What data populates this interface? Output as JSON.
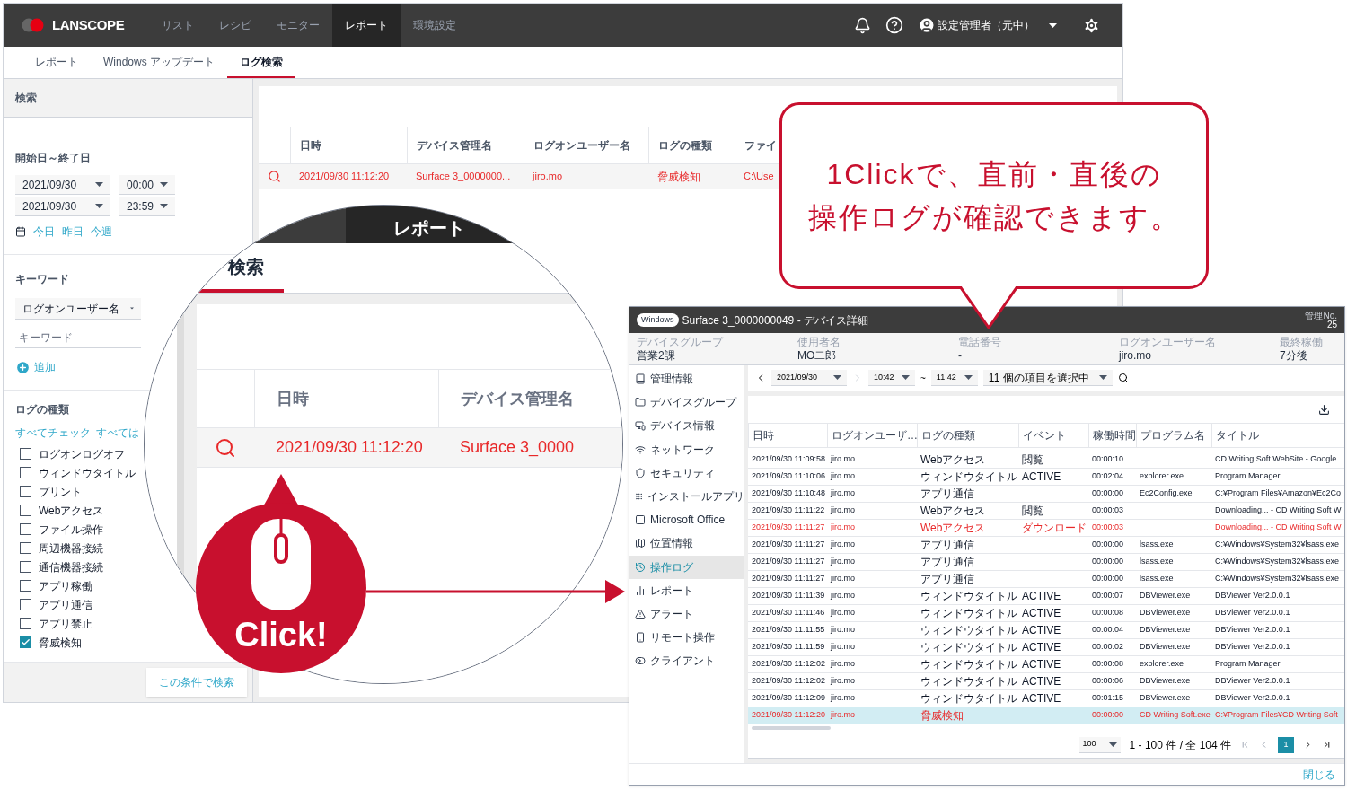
{
  "top_bar": {
    "logo": "LANSCOPE",
    "nav": [
      {
        "label": "リスト",
        "selected": false
      },
      {
        "label": "レシピ",
        "selected": false
      },
      {
        "label": "モニター",
        "selected": false
      },
      {
        "label": "レポート",
        "selected": true
      },
      {
        "label": "環境設定",
        "selected": false
      }
    ],
    "user": "設定管理者（元中）"
  },
  "sub_tabs": [
    {
      "label": "レポート",
      "selected": false
    },
    {
      "label": "Windows アップデート",
      "selected": false
    },
    {
      "label": "ログ検索",
      "selected": true
    }
  ],
  "search_panel": {
    "title": "検索",
    "period": {
      "label": "開始日～終了日",
      "start_date": "2021/09/30",
      "start_time": "00:00",
      "end_date": "2021/09/30",
      "end_time": "23:59",
      "quick_links": [
        "今日",
        "昨日",
        "今週"
      ]
    },
    "keyword": {
      "label": "キーワード",
      "field": "ログオンユーザー名",
      "placeholder": "キーワード",
      "add": "追加"
    },
    "log_types": {
      "label": "ログの種類",
      "check_all": "すべてチェック",
      "uncheck_all": "すべては",
      "items": [
        {
          "label": "ログオンログオフ",
          "checked": false
        },
        {
          "label": "ウィンドウタイトル",
          "checked": false
        },
        {
          "label": "プリント",
          "checked": false
        },
        {
          "label": "Webアクセス",
          "checked": false
        },
        {
          "label": "ファイル操作",
          "checked": false
        },
        {
          "label": "周辺機器接続",
          "checked": false
        },
        {
          "label": "通信機器接続",
          "checked": false
        },
        {
          "label": "アプリ稼働",
          "checked": false
        },
        {
          "label": "アプリ通信",
          "checked": false
        },
        {
          "label": "アプリ禁止",
          "checked": false
        },
        {
          "label": "脅威検知",
          "checked": true
        }
      ]
    },
    "search_button": "この条件で検索"
  },
  "results": {
    "columns": [
      "日時",
      "デバイス管理名",
      "ログオンユーザー名",
      "ログの種類",
      "ファイ"
    ],
    "rows": [
      {
        "cells": [
          "2021/09/30 11:12:20",
          "Surface 3_0000000...",
          "jiro.mo",
          "脅威検知",
          "C:\\Use"
        ],
        "alert": true
      }
    ]
  },
  "magnifier": {
    "tab": "レポート",
    "subtab": "検索",
    "columns": [
      "日時",
      "デバイス管理名"
    ],
    "row": {
      "datetime": "2021/09/30 11:12:20",
      "device": "Surface 3_0000",
      "alert": true
    }
  },
  "click_badge": {
    "label": "Click!"
  },
  "callout": {
    "lines": [
      "1Clickで、直前・直後の",
      "操作ログが確認できます。"
    ]
  },
  "dialog": {
    "os": "Windows",
    "title": "Surface 3_0000000049 - デバイス詳細",
    "mgmt_label": "管理No.",
    "mgmt_no": "25",
    "info": [
      {
        "label": "デバイスグループ",
        "value": "営業2課"
      },
      {
        "label": "使用者名",
        "value": "MO二郎"
      },
      {
        "label": "電話番号",
        "value": "-"
      },
      {
        "label": "ログオンユーザー名",
        "value": "jiro.mo"
      },
      {
        "label": "最終稼働",
        "value": "7分後"
      }
    ],
    "sidebar": [
      {
        "label": "管理情報",
        "selected": false
      },
      {
        "label": "デバイスグループ",
        "selected": false
      },
      {
        "label": "デバイス情報",
        "selected": false
      },
      {
        "label": "ネットワーク",
        "selected": false
      },
      {
        "label": "セキュリティ",
        "selected": false
      },
      {
        "label": "インストールアプリ",
        "selected": false
      },
      {
        "label": "Microsoft Office",
        "selected": false
      },
      {
        "label": "位置情報",
        "selected": false
      },
      {
        "label": "操作ログ",
        "selected": true
      },
      {
        "label": "レポート",
        "selected": false
      },
      {
        "label": "アラート",
        "selected": false
      },
      {
        "label": "リモート操作",
        "selected": false
      },
      {
        "label": "クライアント",
        "selected": false
      }
    ],
    "toolbar": {
      "date": "2021/09/30",
      "from": "10:42",
      "sep": "~",
      "to": "11:42",
      "filter": "11 個の項目を選択中"
    },
    "columns": [
      "日時",
      "ログオンユーザ…",
      "ログの種類",
      "イベント",
      "稼働時間",
      "プログラム名",
      "タイトル"
    ],
    "rows": [
      {
        "datetime": "2021/09/30 11:09:58",
        "user": "jiro.mo",
        "type": "Webアクセス",
        "event": "閲覧",
        "duration": "00:00:10",
        "title": "CD Writing Soft WebSite - Google",
        "alert": false,
        "selected": false
      },
      {
        "datetime": "2021/09/30 11:10:06",
        "user": "jiro.mo",
        "type": "ウィンドウタイトル",
        "event": "ACTIVE",
        "duration": "00:02:04",
        "program": "explorer.exe",
        "title": "Program Manager",
        "alert": false,
        "selected": false
      },
      {
        "datetime": "2021/09/30 11:10:48",
        "user": "jiro.mo",
        "type": "アプリ通信",
        "duration": "00:00:00",
        "program": "Ec2Config.exe",
        "title": "C:¥Program Files¥Amazon¥Ec2Co",
        "alert": false,
        "selected": false
      },
      {
        "datetime": "2021/09/30 11:11:22",
        "user": "jiro.mo",
        "type": "Webアクセス",
        "event": "閲覧",
        "duration": "00:00:03",
        "title": "Downloading... - CD Writing Soft W",
        "alert": false,
        "selected": false
      },
      {
        "datetime": "2021/09/30 11:11:27",
        "user": "jiro.mo",
        "type": "Webアクセス",
        "event": "ダウンロード",
        "duration": "00:00:03",
        "title": "Downloading... - CD Writing Soft W",
        "alert": true,
        "selected": false
      },
      {
        "datetime": "2021/09/30 11:11:27",
        "user": "jiro.mo",
        "type": "アプリ通信",
        "duration": "00:00:00",
        "program": "lsass.exe",
        "title": "C:¥Windows¥System32¥lsass.exe",
        "alert": false,
        "selected": false
      },
      {
        "datetime": "2021/09/30 11:11:27",
        "user": "jiro.mo",
        "type": "アプリ通信",
        "duration": "00:00:00",
        "program": "lsass.exe",
        "title": "C:¥Windows¥System32¥lsass.exe",
        "alert": false,
        "selected": false
      },
      {
        "datetime": "2021/09/30 11:11:27",
        "user": "jiro.mo",
        "type": "アプリ通信",
        "duration": "00:00:00",
        "program": "lsass.exe",
        "title": "C:¥Windows¥System32¥lsass.exe",
        "alert": false,
        "selected": false
      },
      {
        "datetime": "2021/09/30 11:11:39",
        "user": "jiro.mo",
        "type": "ウィンドウタイトル",
        "event": "ACTIVE",
        "duration": "00:00:07",
        "program": "DBViewer.exe",
        "title": "DBViewer Ver2.0.0.1",
        "alert": false,
        "selected": false
      },
      {
        "datetime": "2021/09/30 11:11:46",
        "user": "jiro.mo",
        "type": "ウィンドウタイトル",
        "event": "ACTIVE",
        "duration": "00:00:08",
        "program": "DBViewer.exe",
        "title": "DBViewer Ver2.0.0.1",
        "alert": false,
        "selected": false
      },
      {
        "datetime": "2021/09/30 11:11:55",
        "user": "jiro.mo",
        "type": "ウィンドウタイトル",
        "event": "ACTIVE",
        "duration": "00:00:04",
        "program": "DBViewer.exe",
        "title": "DBViewer Ver2.0.0.1",
        "alert": false,
        "selected": false
      },
      {
        "datetime": "2021/09/30 11:11:59",
        "user": "jiro.mo",
        "type": "ウィンドウタイトル",
        "event": "ACTIVE",
        "duration": "00:00:02",
        "program": "DBViewer.exe",
        "title": "DBViewer Ver2.0.0.1",
        "alert": false,
        "selected": false
      },
      {
        "datetime": "2021/09/30 11:12:02",
        "user": "jiro.mo",
        "type": "ウィンドウタイトル",
        "event": "ACTIVE",
        "duration": "00:00:08",
        "program": "explorer.exe",
        "title": "Program Manager",
        "alert": false,
        "selected": false
      },
      {
        "datetime": "2021/09/30 11:12:02",
        "user": "jiro.mo",
        "type": "ウィンドウタイトル",
        "event": "ACTIVE",
        "duration": "00:00:06",
        "program": "DBViewer.exe",
        "title": "DBViewer Ver2.0.0.1",
        "alert": false,
        "selected": false
      },
      {
        "datetime": "2021/09/30 11:12:09",
        "user": "jiro.mo",
        "type": "ウィンドウタイトル",
        "event": "ACTIVE",
        "duration": "00:01:15",
        "program": "DBViewer.exe",
        "title": "DBViewer Ver2.0.0.1",
        "alert": false,
        "selected": false
      },
      {
        "datetime": "2021/09/30 11:12:20",
        "user": "jiro.mo",
        "type": "脅威検知",
        "duration": "00:00:00",
        "program": "CD Writing Soft.exe",
        "title": "C:¥Program Files¥CD Writing Soft",
        "alert": true,
        "selected": true
      }
    ],
    "pagination": {
      "per_page": "100",
      "range": "1 - 100 件 / 全 104 件",
      "page": "1"
    },
    "close": "閉じる"
  }
}
